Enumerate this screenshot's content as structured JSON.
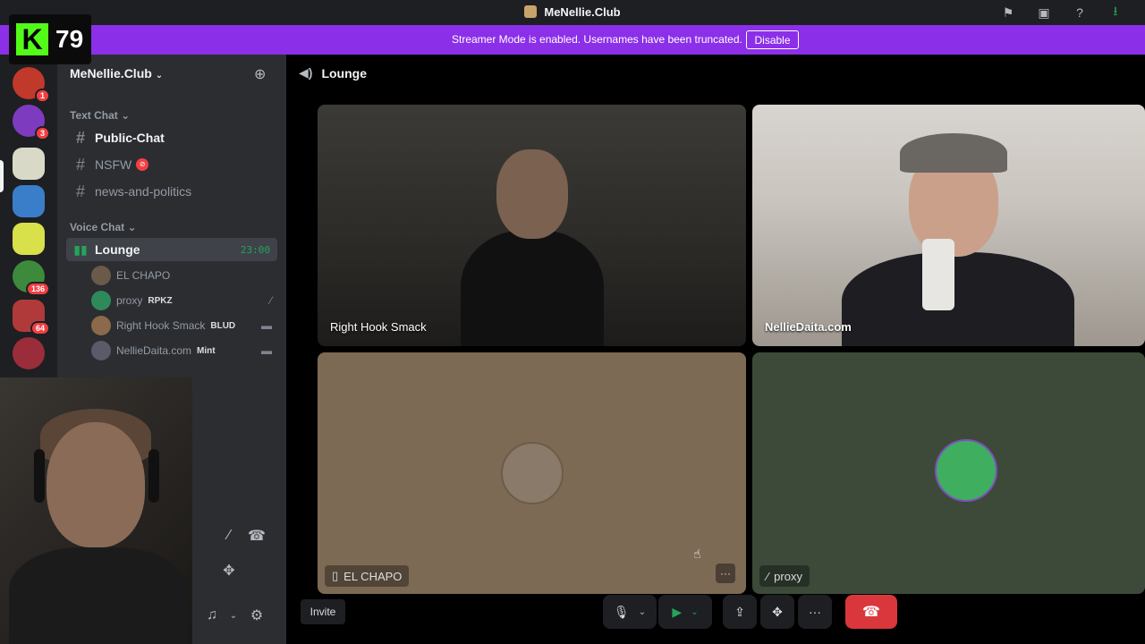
{
  "window": {
    "title": "MeNellie.Club"
  },
  "overlay": {
    "kick_count": "79",
    "kick_logo_letter": "K"
  },
  "banner": {
    "message": "Streamer Mode is enabled. Usernames have been truncated.",
    "disable_label": "Disable",
    "color": "#8c2fe9"
  },
  "servers": [
    {
      "badge": "1",
      "color": "#c0392b"
    },
    {
      "badge": "3",
      "color": "#7d3cbf"
    },
    {
      "badge": "",
      "color": "#d9d9c8"
    },
    {
      "badge": "",
      "color": "#3a7ec9"
    },
    {
      "badge": "",
      "color": "#d8e04a"
    },
    {
      "badge": "136",
      "color": "#3d8a3d"
    },
    {
      "badge": "64",
      "color": "#b03a3a"
    },
    {
      "badge": "",
      "color": "#9b2d3a"
    }
  ],
  "sidebar": {
    "server_name": "MeNellie.Club",
    "text_category": "Text Chat",
    "voice_category": "Voice Chat",
    "text_channels": [
      {
        "name": "Public-Chat"
      },
      {
        "name": "NSFW"
      },
      {
        "name": "news-and-politics"
      }
    ],
    "voice_channel": {
      "name": "Lounge",
      "timer": "23:00"
    },
    "members": [
      {
        "name": "EL CHAPO",
        "tag": "",
        "avatar_color": "#6a5a4a"
      },
      {
        "name": "proxy",
        "tag": "RPKZ",
        "avatar_color": "#2e8a5a"
      },
      {
        "name": "Right Hook Smack",
        "tag": "BLUD",
        "avatar_color": "#8a6a4a"
      },
      {
        "name": "NellieDaita.com",
        "tag": "Mint",
        "avatar_color": "#5a5a6a"
      }
    ]
  },
  "main": {
    "channel_title": "Lounge",
    "tiles": [
      {
        "name": "Right Hook Smack"
      },
      {
        "name": "NellieDaita.com"
      },
      {
        "name": "EL CHAPO"
      },
      {
        "name": "proxy"
      }
    ],
    "invite_label": "Invite",
    "more_glyph": "···"
  },
  "colors": {
    "leave_button": "#da373c",
    "camera_on": "#23a55a",
    "timer": "#23a55a"
  }
}
